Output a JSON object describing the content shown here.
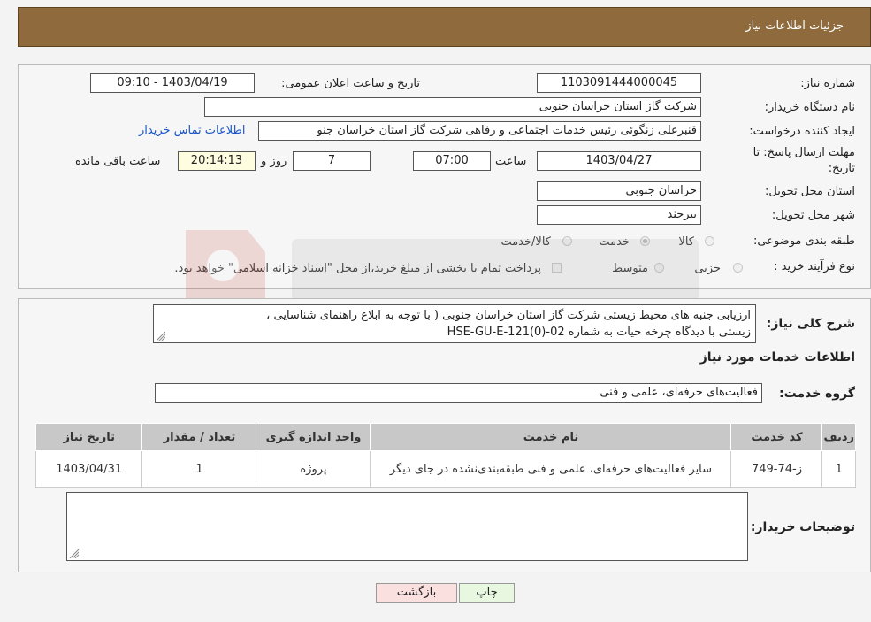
{
  "header": {
    "title": "جزئیات اطلاعات نیاز"
  },
  "form": {
    "need_number_label": "شماره نیاز:",
    "need_number": "1103091444000045",
    "announce_label": "تاریخ و ساعت اعلان عمومی:",
    "announce_value": "1403/04/19 - 09:10",
    "buyer_org_label": "نام دستگاه خریدار:",
    "buyer_org": "شرکت گاز استان خراسان جنوبی",
    "creator_label": "ایجاد کننده درخواست:",
    "creator": "قنبرعلی زنگوئی رئیس خدمات اجتماعی و رفاهی شرکت گاز استان خراسان جنو",
    "contact_link": "اطلاعات تماس خریدار",
    "deadline_label_1": "مهلت ارسال پاسخ: تا",
    "deadline_label_2": "تاریخ:",
    "deadline_date": "1403/04/27",
    "time_label": "ساعت",
    "deadline_time": "07:00",
    "days": "7",
    "days_label": "روز و",
    "remaining_time": "20:14:13",
    "remaining_label": "ساعت باقی مانده",
    "province_label": "استان محل تحویل:",
    "province": "خراسان جنوبی",
    "city_label": "شهر محل تحویل:",
    "city": "بیرجند",
    "category_label": "طبقه بندی موضوعی:",
    "category_options": [
      "کالا",
      "خدمت",
      "کالا/خدمت"
    ],
    "category_selected": "خدمت",
    "process_label": "نوع فرآیند خرید :",
    "process_options": [
      "جزیی",
      "متوسط"
    ],
    "payment_note": "پرداخت تمام یا بخشی از مبلغ خرید،از محل \"اسناد خزانه اسلامی\" خواهد بود."
  },
  "summary": {
    "label": "شرح کلی نیاز:",
    "line1": "ارزیابی جنبه های محیط زیستی شرکت گاز استان خراسان جنوبی ( با توجه به ابلاغ راهنمای شناسایی ،",
    "line2": "زیستی با دیدگاه چرخه حیات به شماره  HSE-GU-E-121(0)-02",
    "services_heading": "اطلاعات خدمات مورد نیاز",
    "group_label": "گروه خدمت:",
    "group_value": "فعالیت‌های حرفه‌ای، علمی و فنی"
  },
  "table": {
    "headers": [
      "ردیف",
      "کد خدمت",
      "نام خدمت",
      "واحد اندازه گیری",
      "تعداد / مقدار",
      "تاریخ نیاز"
    ],
    "rows": [
      [
        "1",
        "ز-74-749",
        "سایر فعالیت‌های حرفه‌ای، علمی و فنی طبقه‌بندی‌نشده در جای دیگر",
        "پروژه",
        "1",
        "1403/04/31"
      ]
    ]
  },
  "buyer_notes": {
    "label": "توضیحات خریدار:",
    "value": ""
  },
  "buttons": {
    "print": "چاپ",
    "back": "بازگشت"
  },
  "colors": {
    "header_bg": "#8f6a3c",
    "link": "#1a55c8",
    "print_bg": "#e8f8e0",
    "back_bg": "#fbe0e0"
  }
}
